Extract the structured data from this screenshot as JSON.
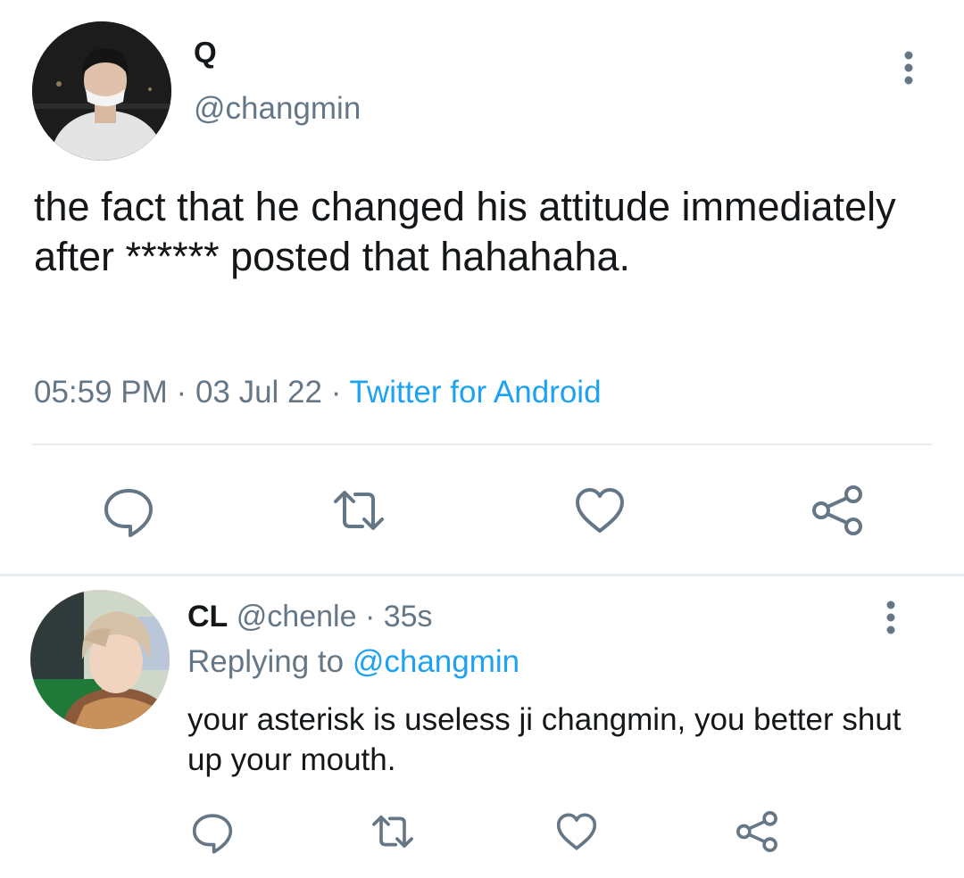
{
  "tweet": {
    "name": "Q",
    "handle": "@changmin",
    "text": "the fact that he changed his attitude immediately after ****** posted that hahahaha.",
    "time": "05:59 PM",
    "date": "03 Jul 22",
    "source": "Twitter for Android",
    "actions": [
      "comment-icon",
      "retweet-icon",
      "heart-icon",
      "share-icon"
    ]
  },
  "reply": {
    "name": "CL",
    "handle": "@chenle",
    "age": "35s",
    "replying_prefix": "Replying to",
    "replying_handle": "@changmin",
    "text": "your asterisk is useless ji changmin, you better shut up your mouth."
  },
  "colors": {
    "link": "#1da1f2",
    "secondary": "#657786",
    "icon": "#657786",
    "divider": "#e6ecf0"
  }
}
